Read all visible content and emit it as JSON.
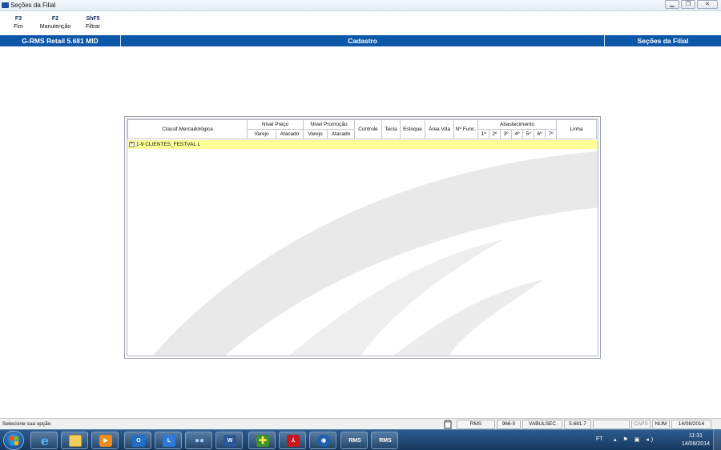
{
  "window": {
    "title": "Seções da Filial",
    "controls": [
      "minimize",
      "restore",
      "close"
    ]
  },
  "fkeys": [
    {
      "key": "F3",
      "label": "Fim"
    },
    {
      "key": "F2",
      "label": "Manutenção"
    },
    {
      "key": "ShF5",
      "label": "Filtrar"
    }
  ],
  "header": {
    "left": "G-RMS Retail 5.681 MID",
    "center": "Cadastro",
    "right": "Seções da Filial"
  },
  "grid": {
    "columns": {
      "classif": "Classif.Mercadológica",
      "nivel_preco": "Nível Preço",
      "nivel_promocao": "Nível Promoção",
      "varejo1": "Varejo",
      "atacado1": "Atacado",
      "varejo2": "Varejo",
      "atacado2": "Atacado",
      "controle": "Controle",
      "tecla": "Tecla",
      "estoque": "Estoque",
      "area_vda": "Área Vda",
      "n_func": "Nº Func.",
      "abastecimento": "Abastecimento",
      "abast": [
        "1º",
        "2º",
        "3º",
        "4º",
        "5º",
        "6º",
        "7º"
      ],
      "linha": "Linha"
    },
    "rows": [
      {
        "expander": "+",
        "label": "1-9 CLIENTES_FESTVAL L"
      }
    ]
  },
  "statusbar": {
    "message": "Selecione sua opção",
    "cells": [
      "RMS",
      "966-0",
      "VABULSEC",
      "5.681.7",
      "",
      "CAPS",
      "NUM",
      "14/08/2014"
    ]
  },
  "taskbar": {
    "apps": [
      "ie-icon",
      "explorer-icon",
      "media-player-icon",
      "outlook-icon",
      "lync-icon",
      "meeting-icon",
      "word-icon",
      "medical-app-icon",
      "acrobat-icon",
      "remote-icon",
      "rms-app-1",
      "rms-app-2"
    ],
    "app_labels": {
      "outlook": "O",
      "lync": "L",
      "word": "W",
      "rms1": "RMS",
      "rms2": "RMS"
    },
    "tray_lang": "FT",
    "time": "11:31",
    "date": "14/08/2014"
  }
}
